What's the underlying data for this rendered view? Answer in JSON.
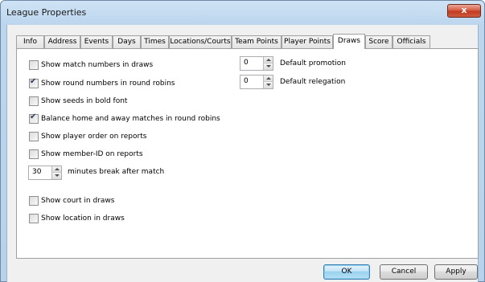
{
  "window": {
    "title": "League Properties",
    "close_glyph": "x"
  },
  "tabs": [
    {
      "label": "Info"
    },
    {
      "label": "Address"
    },
    {
      "label": "Events"
    },
    {
      "label": "Days"
    },
    {
      "label": "Times"
    },
    {
      "label": "Locations/Courts"
    },
    {
      "label": "Team Points"
    },
    {
      "label": "Player Points"
    },
    {
      "label": "Draws",
      "active": true
    },
    {
      "label": "Score"
    },
    {
      "label": "Officials"
    }
  ],
  "options": [
    {
      "label": "Show match numbers in draws",
      "checked": false
    },
    {
      "label": "Show round numbers in round robins",
      "checked": true
    },
    {
      "label": "Show seeds in bold font",
      "checked": false
    },
    {
      "label": "Balance home and away matches in round robins",
      "checked": true
    },
    {
      "label": "Show player order on reports",
      "checked": false
    },
    {
      "label": "Show member-ID on reports",
      "checked": false
    },
    {
      "label": "Show court in draws",
      "checked": false
    },
    {
      "label": "Show location in draws",
      "checked": false
    }
  ],
  "break_minutes": {
    "value": "30",
    "label": "minutes break after match"
  },
  "promotion": {
    "value": "0",
    "label": "Default promotion"
  },
  "relegation": {
    "value": "0",
    "label": "Default relegation"
  },
  "buttons": {
    "ok": "OK",
    "cancel": "Cancel",
    "apply": "Apply"
  },
  "colors": {
    "accent": "#3c7fb1",
    "close": "#c0391f"
  }
}
